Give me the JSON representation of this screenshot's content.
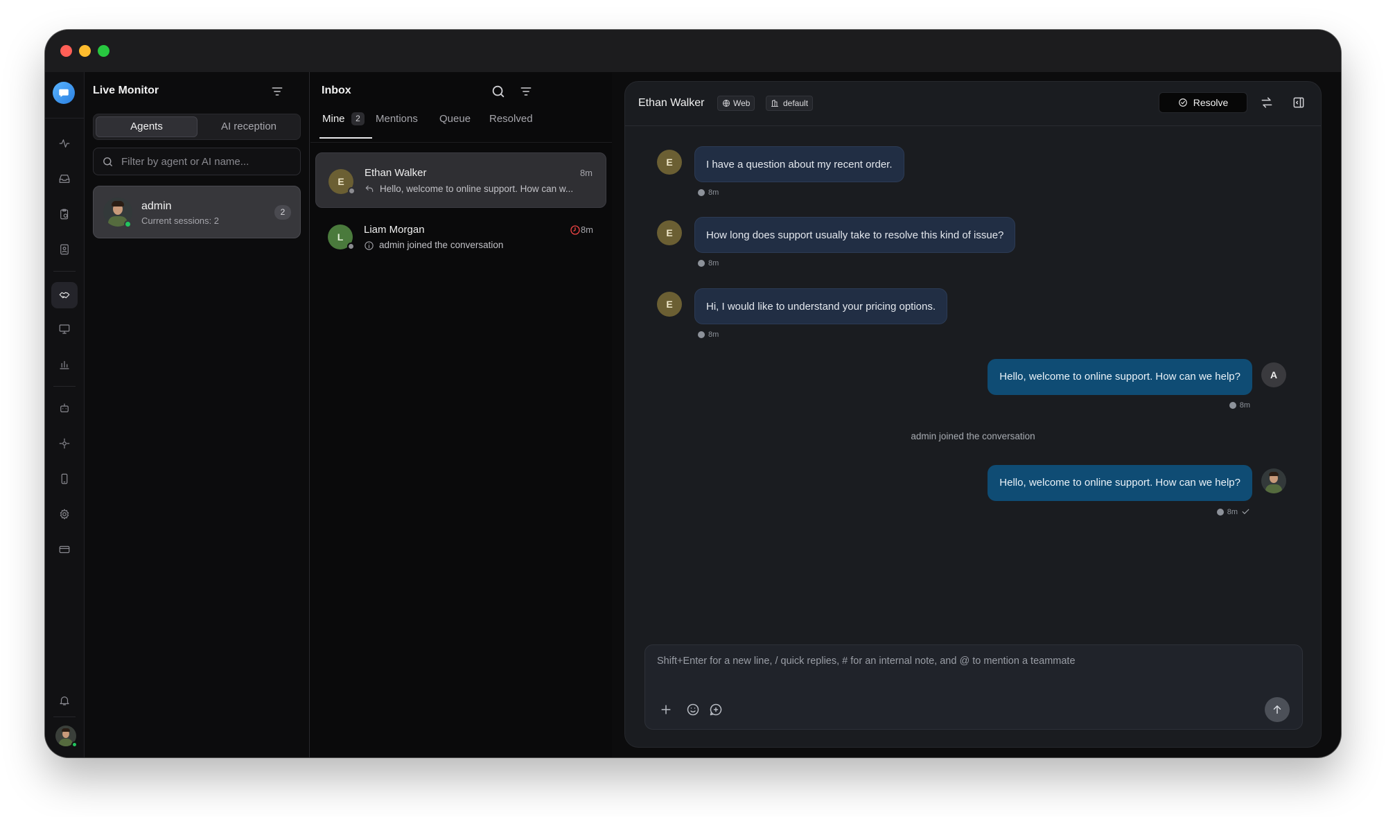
{
  "colors": {
    "accent": "#0f4c74",
    "online": "#22c55e",
    "warning_clock": "#ef4444",
    "avatar_e": "#6b5f33",
    "avatar_l": "#4a7a3c"
  },
  "sidebar_icons": [
    "app-logo-icon",
    "activity-icon",
    "inbox-icon",
    "clipboard-clock-icon",
    "contact-book-icon",
    "handshake-icon",
    "monitor-icon",
    "bar-chart-icon",
    "bot-icon",
    "integration-icon",
    "smartphone-icon",
    "settings-gear-icon",
    "credit-card-icon",
    "bell-icon"
  ],
  "monitor": {
    "title": "Live Monitor",
    "segments": [
      "Agents",
      "AI reception"
    ],
    "filter_placeholder": "Filter by agent or AI name...",
    "agent": {
      "name": "admin",
      "sessions": "Current sessions: 2",
      "count": "2"
    }
  },
  "inbox": {
    "title": "Inbox",
    "tabs": [
      {
        "label": "Mine",
        "count": "2"
      },
      {
        "label": "Mentions"
      },
      {
        "label": "Queue"
      },
      {
        "label": "Resolved"
      }
    ],
    "conversations": [
      {
        "initial": "E",
        "name": "Ethan Walker",
        "time": "8m",
        "preview": "Hello, welcome to online support. How can w..."
      },
      {
        "initial": "L",
        "name": "Liam Morgan",
        "time": "8m",
        "preview": "admin joined the conversation"
      }
    ]
  },
  "chat": {
    "contact": "Ethan Walker",
    "channel": "Web",
    "inbox_tag": "default",
    "resolve_label": "Resolve",
    "messages": [
      {
        "text": "I have a question about my recent order.",
        "time": "8m"
      },
      {
        "text": "How long does support usually take to resolve this kind of issue?",
        "time": "8m"
      },
      {
        "text": "Hi, I would like to understand your pricing options.",
        "time": "8m"
      },
      {
        "text": "Hello, welcome to online support. How can we help?",
        "time": "8m",
        "avatar": "A"
      },
      {
        "text": "admin joined the conversation"
      },
      {
        "text": "Hello, welcome to online support. How can we help?",
        "time": "8m"
      }
    ],
    "composer_placeholder": "Shift+Enter for a new line, / quick replies, # for an internal note, and @ to mention a teammate"
  }
}
